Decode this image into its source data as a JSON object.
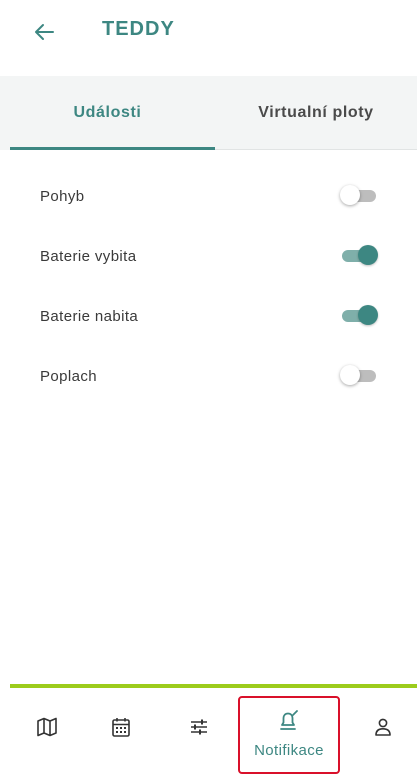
{
  "header": {
    "title": "TEDDY",
    "back_icon": "arrow-left-icon"
  },
  "tabs": [
    {
      "label": "Události",
      "active": true
    },
    {
      "label": "Virtualní ploty",
      "active": false
    }
  ],
  "settings": [
    {
      "label": "Pohyb",
      "enabled": false
    },
    {
      "label": "Baterie vybita",
      "enabled": true
    },
    {
      "label": "Baterie nabita",
      "enabled": true
    },
    {
      "label": "Poplach",
      "enabled": false
    }
  ],
  "bottom_nav": {
    "items": [
      {
        "icon": "map-icon"
      },
      {
        "icon": "calendar-icon"
      },
      {
        "icon": "sliders-icon"
      },
      {
        "icon": "bell-edit-icon",
        "label": "Notifikace",
        "active": true
      },
      {
        "icon": "person-icon"
      }
    ]
  },
  "colors": {
    "accent": "#3d8782",
    "toggle_track_on": "#7fafaa",
    "toggle_off": "#bdbdbd",
    "bottom_accent_line": "#9ccc1c",
    "highlight_border": "#d9102a",
    "tab_bar_bg": "#f3f5f5"
  }
}
